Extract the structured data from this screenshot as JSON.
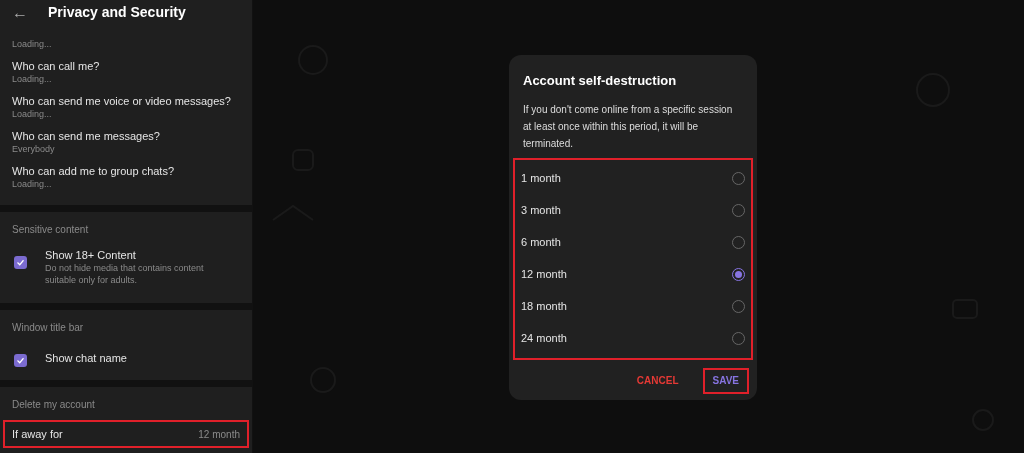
{
  "header": {
    "back": "←",
    "title": "Privacy and Security"
  },
  "privacy_items": [
    {
      "value": "Loading..."
    },
    {
      "title": "Who can call me?",
      "value": "Loading..."
    },
    {
      "title": "Who can send me voice or video messages?",
      "value": "Loading..."
    },
    {
      "title": "Who can send me messages?",
      "value": "Everybody"
    },
    {
      "title": "Who can add me to group chats?",
      "value": "Loading..."
    }
  ],
  "sections": [
    {
      "heading": "Sensitive content",
      "items": [
        {
          "kind": "checkbox",
          "label": "Show 18+ Content",
          "description": "Do not hide media that contains content suitable only for adults.",
          "checked": true
        }
      ]
    },
    {
      "heading": "Window title bar",
      "items": [
        {
          "kind": "checkbox",
          "label": "Show chat name",
          "checked": true
        }
      ]
    },
    {
      "heading": "Delete my account",
      "items": [
        {
          "kind": "value",
          "label": "If away for",
          "value": "12 month",
          "highlighted": true
        }
      ]
    }
  ],
  "dialog": {
    "title": "Account self-destruction",
    "text": "If you don't come online from a specific session at least once within this period, it will be terminated.",
    "options_highlighted": true,
    "options": [
      {
        "label": "1 month",
        "selected": false
      },
      {
        "label": "3 month",
        "selected": false
      },
      {
        "label": "6 month",
        "selected": false
      },
      {
        "label": "12 month",
        "selected": true
      },
      {
        "label": "18 month",
        "selected": false
      },
      {
        "label": "24 month",
        "selected": false
      }
    ],
    "buttons": [
      {
        "label": "CANCEL",
        "kind": "cancel",
        "highlighted": false
      },
      {
        "label": "SAVE",
        "kind": "save",
        "highlighted": true
      }
    ]
  }
}
